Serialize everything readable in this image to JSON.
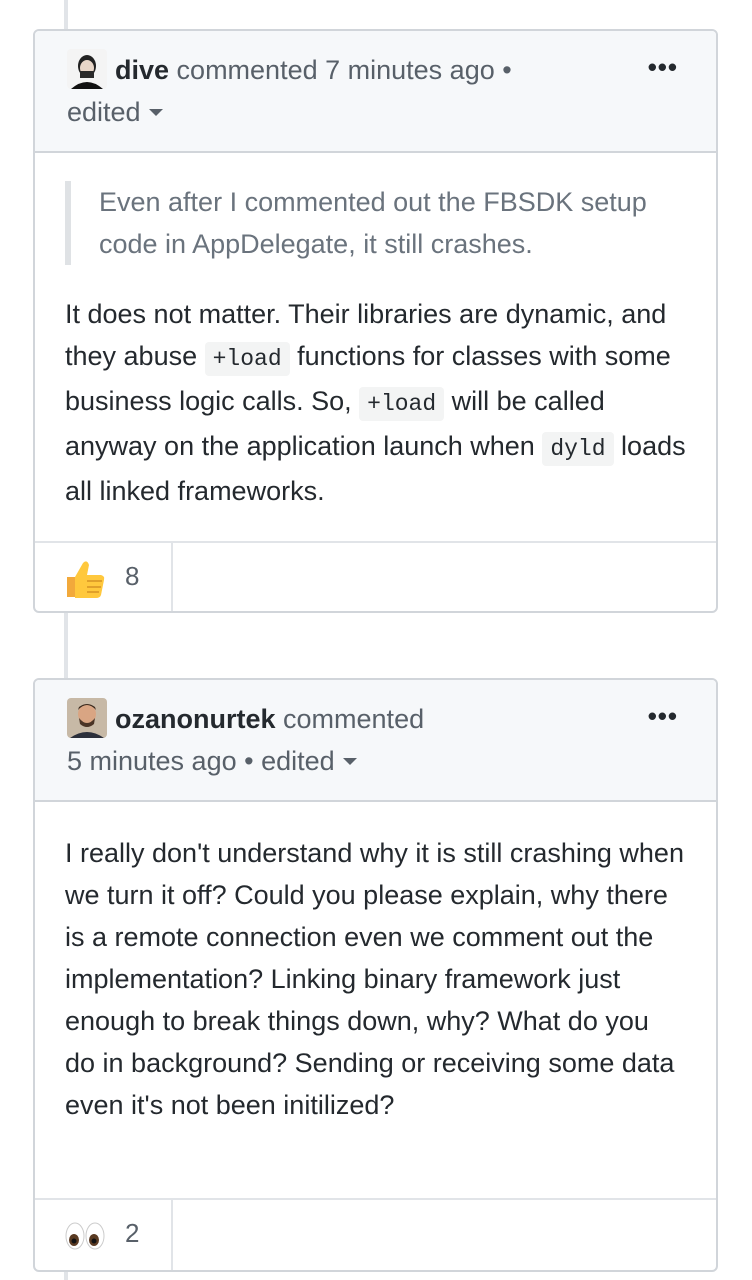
{
  "comments": [
    {
      "author": "dive",
      "action": "commented 7 minutes ago",
      "separator": "•",
      "edited": "edited",
      "menu": "•••",
      "quote": "Even after I commented out the FBSDK setup code in AppDelegate, it still crashes.",
      "body": {
        "t1": "It does not matter. Their libraries are dynamic, and they abuse ",
        "code1": "+load",
        "t2": " functions for classes with some business logic calls. So, ",
        "code2": "+load",
        "t3": " will be called anyway on the application launch when ",
        "code3": "dyld",
        "t4": " loads all linked frameworks."
      },
      "reaction": {
        "icon": "thumbs-up-emoji",
        "count": "8"
      }
    },
    {
      "author": "ozanonurtek",
      "action": "commented",
      "time": "5 minutes ago",
      "separator": "•",
      "edited": "edited",
      "menu": "•••",
      "body": "I really don't understand why it is still crashing when we turn it off? Could you please explain, why there is a remote connection even we comment out the implementation? Linking binary framework just enough to break things down, why? What do you do in background? Sending or receiving some data even it's not been initilized?",
      "reaction": {
        "icon": "eyes-emoji",
        "count": "2"
      }
    }
  ],
  "colors": {
    "header_bg": "#f6f8fa",
    "border": "#d1d5da",
    "muted_text": "#586069",
    "quote_text": "#6a737d"
  }
}
